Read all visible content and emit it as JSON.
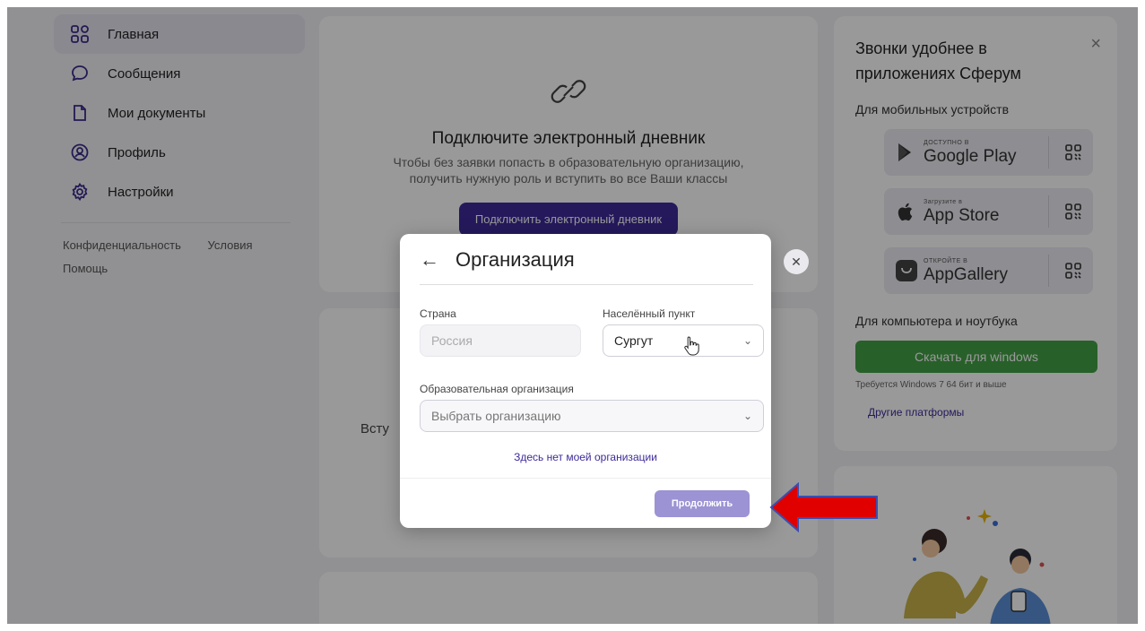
{
  "sidebar": {
    "items": [
      {
        "label": "Главная",
        "icon": "grid-icon",
        "active": true
      },
      {
        "label": "Сообщения",
        "icon": "chat-bubble-icon"
      },
      {
        "label": "Мои документы",
        "icon": "document-icon"
      },
      {
        "label": "Профиль",
        "icon": "user-circle-icon"
      },
      {
        "label": "Настройки",
        "icon": "gear-icon"
      }
    ],
    "links": {
      "privacy": "Конфиденциальность",
      "terms": "Условия",
      "help": "Помощь"
    }
  },
  "diary_card": {
    "title": "Подключите электронный дневник",
    "description_line1": "Чтобы без заявки попасть в образовательную организацию,",
    "description_line2": "получить нужную роль и вступить во все Ваши классы",
    "button": "Подключить электронный дневник"
  },
  "second_card": {
    "partial_text": "Всту"
  },
  "promo": {
    "title": "Звонки удобнее в приложениях Сферум",
    "close": "×",
    "mobile_label": "Для мобильных устройств",
    "stores": [
      {
        "small": "ДОСТУПНО В",
        "name": "Google Play",
        "icon": "google-play-icon"
      },
      {
        "small": "Загрузите в",
        "name": "App Store",
        "icon": "apple-icon"
      },
      {
        "small": "ОТКРОЙТЕ В",
        "name": "AppGallery",
        "icon": "huawei-icon"
      }
    ],
    "desktop_label": "Для компьютера и ноутбука",
    "download_button": "Скачать для windows",
    "requirement": "Требуется Windows 7 64 бит и выше",
    "other_platforms": "Другие платформы"
  },
  "modal": {
    "title": "Организация",
    "back": "←",
    "country_label": "Страна",
    "country_value": "Россия",
    "city_label": "Населённый пункт",
    "city_value": "Сургут",
    "org_label": "Образовательная организация",
    "org_placeholder": "Выбрать организацию",
    "not_found": "Здесь нет моей организации",
    "continue_button": "Продолжить",
    "close": "✕"
  },
  "colors": {
    "accent": "#3f2a9a",
    "continue": "#9b93d4",
    "download": "#43a047",
    "annotation_arrow": "#e00000"
  }
}
